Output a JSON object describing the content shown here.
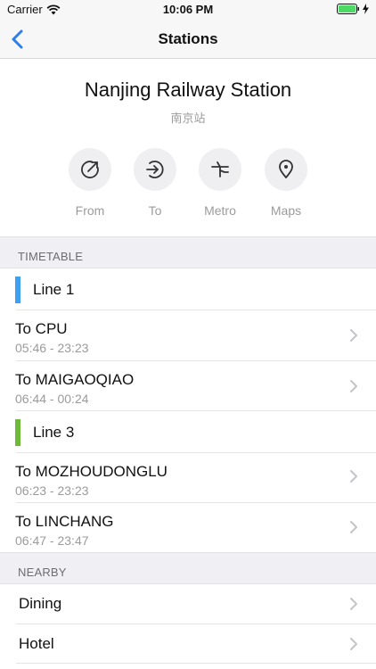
{
  "status_bar": {
    "carrier": "Carrier",
    "time": "10:06 PM"
  },
  "nav": {
    "title": "Stations"
  },
  "station": {
    "name": "Nanjing Railway Station",
    "native_name": "南京站"
  },
  "actions": [
    {
      "label": "From",
      "icon": "arrow-up-right-circle-icon"
    },
    {
      "label": "To",
      "icon": "arrow-enter-circle-icon"
    },
    {
      "label": "Metro",
      "icon": "metro-junction-icon"
    },
    {
      "label": "Maps",
      "icon": "map-pin-icon"
    }
  ],
  "timetable": {
    "header": "TIMETABLE",
    "lines": [
      {
        "name": "Line 1",
        "color": "#3ea0f0",
        "destinations": [
          {
            "to": "To CPU",
            "hours": "05:46 - 23:23"
          },
          {
            "to": "To MAIGAOQIAO",
            "hours": "06:44 - 00:24"
          }
        ]
      },
      {
        "name": "Line 3",
        "color": "#6fb93a",
        "destinations": [
          {
            "to": "To MOZHOUDONGLU",
            "hours": "06:23 - 23:23"
          },
          {
            "to": "To LINCHANG",
            "hours": "06:47 - 23:47"
          }
        ]
      }
    ]
  },
  "nearby": {
    "header": "NEARBY",
    "items": [
      {
        "label": "Dining"
      },
      {
        "label": "Hotel"
      }
    ]
  },
  "colors": {
    "accent": "#2f7fe6",
    "secondary_text": "#9b9b9b",
    "group_background": "#efeff4"
  }
}
